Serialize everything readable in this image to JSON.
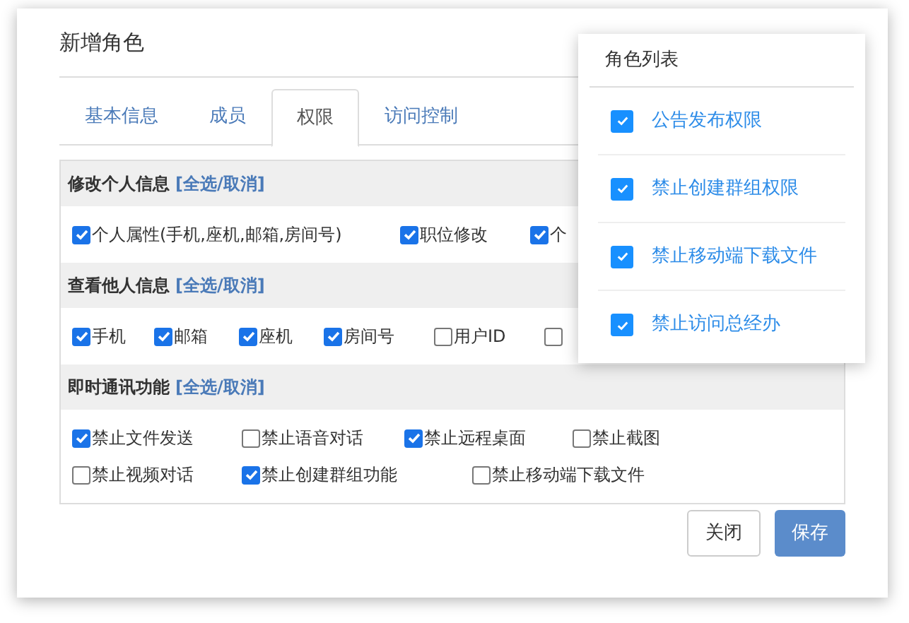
{
  "dialog": {
    "title": "新增角色",
    "tabs": [
      {
        "label": "基本信息",
        "selected": false
      },
      {
        "label": "成员",
        "selected": false
      },
      {
        "label": "权限",
        "selected": true
      },
      {
        "label": "访问控制",
        "selected": false
      }
    ],
    "sections": [
      {
        "title": "修改个人信息",
        "toggle": "[全选/取消]",
        "rows": [
          [
            {
              "label": "个人属性(手机,座机,邮箱,房间号)",
              "checked": true
            },
            {
              "label": "职位修改",
              "checked": true
            },
            {
              "label": "个",
              "checked": true
            }
          ]
        ]
      },
      {
        "title": "查看他人信息",
        "toggle": "[全选/取消]",
        "rows": [
          [
            {
              "label": "手机",
              "checked": true
            },
            {
              "label": "邮箱",
              "checked": true
            },
            {
              "label": "座机",
              "checked": true
            },
            {
              "label": "房间号",
              "checked": true
            },
            {
              "label": "用户ID",
              "checked": false
            },
            {
              "checked": false
            }
          ]
        ]
      },
      {
        "title": "即时通讯功能",
        "toggle": "[全选/取消]",
        "rows": [
          [
            {
              "label": "禁止文件发送",
              "checked": true
            },
            {
              "label": "禁止语音对话",
              "checked": false
            },
            {
              "label": "禁止远程桌面",
              "checked": true
            },
            {
              "label": "禁止截图",
              "checked": false
            }
          ],
          [
            {
              "label": "禁止视频对话",
              "checked": false
            },
            {
              "label": "禁止创建群组功能",
              "checked": true
            },
            {
              "label": "禁止移动端下载文件",
              "checked": false
            }
          ]
        ]
      }
    ],
    "buttons": [
      {
        "label": "关闭",
        "kind": "secondary"
      },
      {
        "label": "保存",
        "kind": "primary"
      }
    ]
  },
  "role_list": {
    "title": "角色列表",
    "items": [
      {
        "label": "公告发布权限",
        "checked": true
      },
      {
        "label": "禁止创建群组权限",
        "checked": true
      },
      {
        "label": "禁止移动端下载文件",
        "checked": true
      },
      {
        "label": "禁止访问总经办",
        "checked": true
      }
    ]
  }
}
